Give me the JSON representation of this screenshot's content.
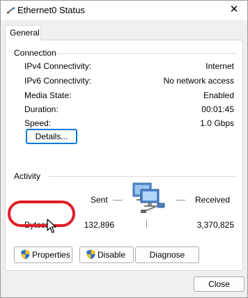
{
  "window": {
    "title": "Ethernet0 Status",
    "close_glyph": "✕"
  },
  "tabs": [
    {
      "label": "General",
      "selected": true
    }
  ],
  "connection": {
    "heading": "Connection",
    "rows": [
      {
        "label": "IPv4 Connectivity:",
        "value": "Internet"
      },
      {
        "label": "IPv6 Connectivity:",
        "value": "No network access"
      },
      {
        "label": "Media State:",
        "value": "Enabled"
      },
      {
        "label": "Duration:",
        "value": "00:01:45"
      },
      {
        "label": "Speed:",
        "value": "1.0 Gbps"
      }
    ],
    "details_button": "Details..."
  },
  "activity": {
    "heading": "Activity",
    "sent_label": "Sent",
    "received_label": "Received",
    "bytes_label": "Bytes:",
    "bytes_sent": "132,896",
    "bytes_received": "3,370,825"
  },
  "actions": {
    "properties": "Properties",
    "disable": "Disable",
    "diagnose": "Diagnose"
  },
  "footer": {
    "close": "Close"
  },
  "colors": {
    "highlight": "#e01d26",
    "focus": "#0078d7"
  },
  "icons": {
    "title": "network-cable-icon",
    "activity": "network-computers-icon",
    "shield": "uac-shield-icon",
    "cursor": "mouse-pointer-icon"
  }
}
